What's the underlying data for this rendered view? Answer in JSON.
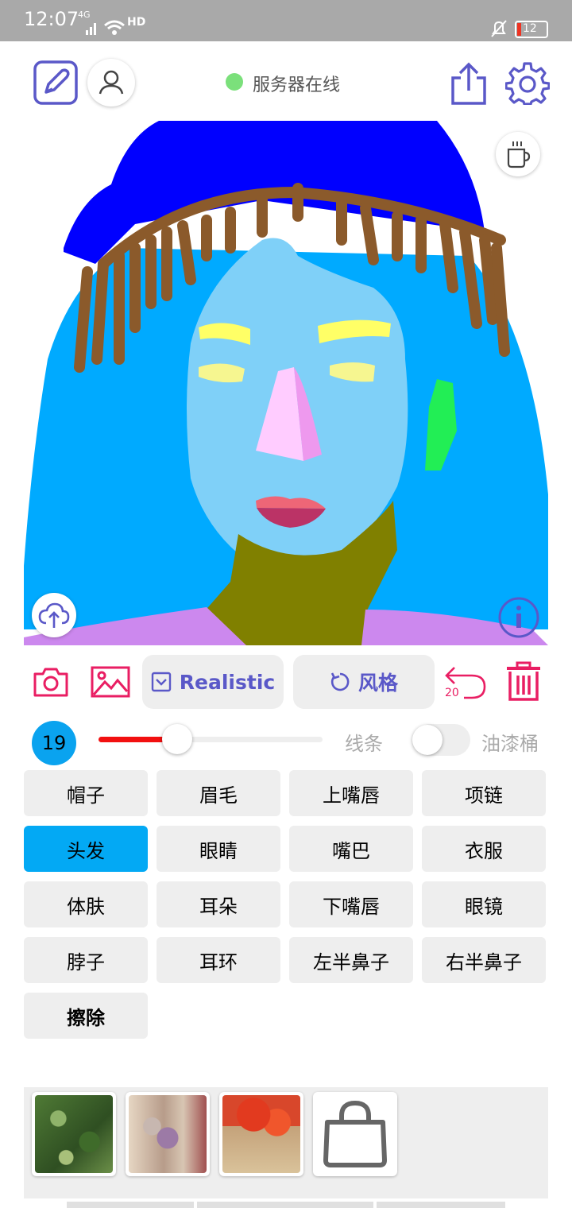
{
  "status_bar": {
    "time": "12:07",
    "network": "4G",
    "hd": "HD",
    "battery": "12"
  },
  "header": {
    "server_status": "服务器在线"
  },
  "actions": {
    "realistic_label": "Realistic",
    "style_label": "风格",
    "undo_count": "20"
  },
  "brush": {
    "size": "19",
    "size_fill": 0.35,
    "lines_label": "线条",
    "bucket_label": "油漆桶"
  },
  "labels": [
    {
      "text": "帽子"
    },
    {
      "text": "眉毛"
    },
    {
      "text": "上嘴唇"
    },
    {
      "text": "项链"
    },
    {
      "text": "头发"
    },
    {
      "text": "眼睛"
    },
    {
      "text": "嘴巴"
    },
    {
      "text": "衣服"
    },
    {
      "text": "体肤"
    },
    {
      "text": "耳朵"
    },
    {
      "text": "下嘴唇"
    },
    {
      "text": "眼镜"
    },
    {
      "text": "脖子"
    },
    {
      "text": "耳环"
    },
    {
      "text": "左半鼻子"
    },
    {
      "text": "右半鼻子"
    },
    {
      "text": "擦除"
    }
  ],
  "selected_label": "头发",
  "colors": {
    "accent": "#5a58c8",
    "danger": "#e91e63",
    "active": "#03a9f4",
    "slider": "#f21010",
    "hat": "#0000ff",
    "hair": "#00aaff",
    "hair_strands": "#8b5a2b",
    "skin": "#7fd0f8",
    "eyebrows": "#ffff66",
    "eyes": "#f6f690",
    "nose_left": "#ffccff",
    "nose_right": "#ee99ee",
    "upper_lip": "#ee6677",
    "lower_lip": "#bb3366",
    "neck": "#808000",
    "clothes": "#cc88ee",
    "ear": "#22ee55"
  },
  "icons": [
    "edit-icon",
    "user-icon",
    "share-icon",
    "settings-icon",
    "coffee-icon",
    "upload-icon",
    "info-icon",
    "camera-icon",
    "image-icon",
    "checkbox-icon",
    "refresh-icon",
    "undo-icon",
    "trash-icon",
    "shopping-bag-icon"
  ]
}
